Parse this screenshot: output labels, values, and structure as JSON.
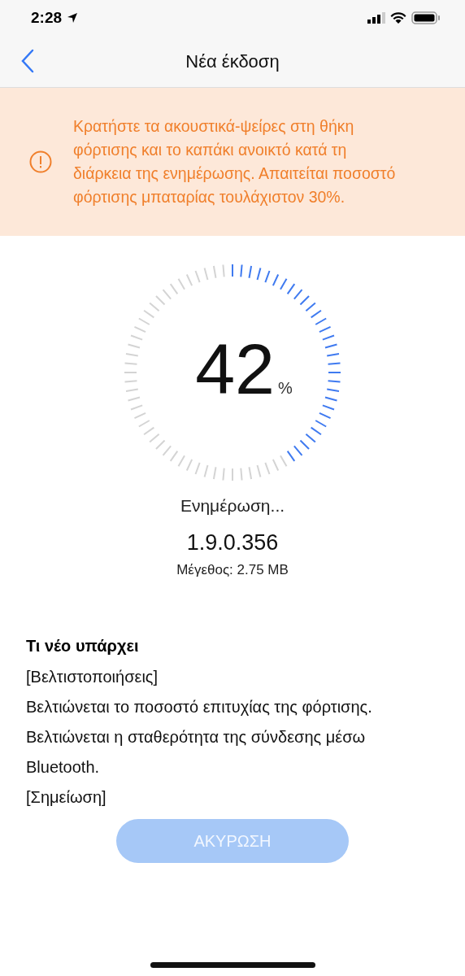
{
  "status_bar": {
    "time": "2:28"
  },
  "nav": {
    "title": "Νέα έκδοση"
  },
  "notice": {
    "text": "Κρατήστε τα ακουστικά-ψείρες στη θήκη φόρτισης και το καπάκι ανοικτό κατά τη διάρκεια της ενημέρωσης. Απαιτείται ποσοστό φόρτισης μπαταρίας τουλάχιστον 30%."
  },
  "progress": {
    "value": "42",
    "unit": "%",
    "status": "Ενημέρωση...",
    "version": "1.9.0.356",
    "size": "Μέγεθος: 2.75 MB"
  },
  "whats_new": {
    "title": "Τι νέο υπάρχει",
    "lines": [
      "[Βελτιστοποιήσεις]",
      "Βελτιώνεται το ποσοστό επιτυχίας της φόρτισης.",
      "Βελτιώνεται η σταθερότητα της σύνδεσης μέσω Bluetooth.",
      "[Σημείωση]"
    ]
  },
  "cancel_button": {
    "label": "ΑΚΥΡΩΣΗ",
    "disabled": true
  }
}
